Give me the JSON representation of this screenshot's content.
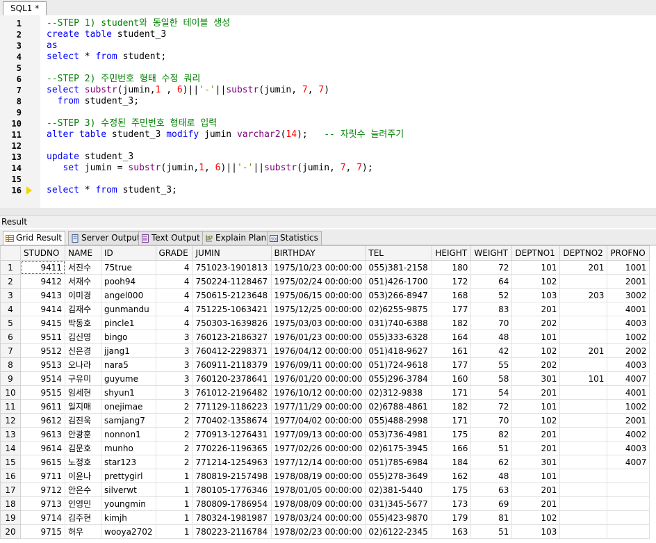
{
  "tab": {
    "title": "SQL1 *"
  },
  "editor": {
    "lines": [
      {
        "n": "1",
        "parts": [
          [
            "cmt",
            "--STEP 1) student와 동일한 테이블 생성"
          ]
        ]
      },
      {
        "n": "2",
        "parts": [
          [
            "kw",
            "create table "
          ],
          [
            "",
            "student_3"
          ]
        ]
      },
      {
        "n": "3",
        "parts": [
          [
            "kw",
            "as"
          ]
        ]
      },
      {
        "n": "4",
        "parts": [
          [
            "kw",
            "select "
          ],
          [
            "",
            "* "
          ],
          [
            "kw",
            "from "
          ],
          [
            "",
            "student;"
          ]
        ]
      },
      {
        "n": "5",
        "parts": []
      },
      {
        "n": "6",
        "parts": [
          [
            "cmt",
            "--STEP 2) 주민번호 형태 수정 쿼리"
          ]
        ]
      },
      {
        "n": "7",
        "parts": [
          [
            "kw",
            "select "
          ],
          [
            "fn",
            "substr"
          ],
          [
            "",
            "(jumin,"
          ],
          [
            "num",
            "1"
          ],
          [
            "",
            " , "
          ],
          [
            "num",
            "6"
          ],
          [
            "",
            ")||"
          ],
          [
            "str",
            "'-'"
          ],
          [
            "",
            "||"
          ],
          [
            "fn",
            "substr"
          ],
          [
            "",
            "(jumin, "
          ],
          [
            "num",
            "7"
          ],
          [
            "",
            ", "
          ],
          [
            "num",
            "7"
          ],
          [
            "",
            ")"
          ]
        ]
      },
      {
        "n": "8",
        "parts": [
          [
            "",
            "  "
          ],
          [
            "kw",
            "from "
          ],
          [
            "",
            "student_3;"
          ]
        ]
      },
      {
        "n": "9",
        "parts": []
      },
      {
        "n": "10",
        "parts": [
          [
            "cmt",
            "--STEP 3) 수정된 주민번호 형태로 입력"
          ]
        ]
      },
      {
        "n": "11",
        "parts": [
          [
            "kw",
            "alter table "
          ],
          [
            "",
            "student_3 "
          ],
          [
            "kw",
            "modify "
          ],
          [
            "",
            "jumin "
          ],
          [
            "fn",
            "varchar2"
          ],
          [
            "",
            "("
          ],
          [
            "num",
            "14"
          ],
          [
            "",
            ");   "
          ],
          [
            "cmt",
            "-- 자릿수 늘려주기"
          ]
        ]
      },
      {
        "n": "12",
        "parts": []
      },
      {
        "n": "13",
        "parts": [
          [
            "kw",
            "update "
          ],
          [
            "",
            "student_3"
          ]
        ]
      },
      {
        "n": "14",
        "parts": [
          [
            "",
            "   "
          ],
          [
            "kw",
            "set "
          ],
          [
            "",
            "jumin = "
          ],
          [
            "fn",
            "substr"
          ],
          [
            "",
            "(jumin,"
          ],
          [
            "num",
            "1"
          ],
          [
            "",
            ", "
          ],
          [
            "num",
            "6"
          ],
          [
            "",
            ")||"
          ],
          [
            "str",
            "'-'"
          ],
          [
            "",
            "||"
          ],
          [
            "fn",
            "substr"
          ],
          [
            "",
            "(jumin, "
          ],
          [
            "num",
            "7"
          ],
          [
            "",
            ", "
          ],
          [
            "num",
            "7"
          ],
          [
            "",
            ");"
          ]
        ]
      },
      {
        "n": "15",
        "parts": []
      },
      {
        "n": "16",
        "parts": [
          [
            "kw",
            "select "
          ],
          [
            "",
            "* "
          ],
          [
            "kw",
            "from "
          ],
          [
            "",
            "student_3;"
          ]
        ],
        "current": true
      }
    ]
  },
  "result": {
    "title": "Result",
    "tabs": [
      {
        "label": "Grid Result",
        "icon": "grid-icon",
        "active": true
      },
      {
        "label": "Server Output",
        "icon": "server-output-icon"
      },
      {
        "label": "Text Output",
        "icon": "text-output-icon"
      },
      {
        "label": "Explain Plan",
        "icon": "explain-plan-icon"
      },
      {
        "label": "Statistics",
        "icon": "statistics-icon"
      }
    ],
    "columns": [
      "STUDNO",
      "NAME",
      "ID",
      "GRADE",
      "JUMIN",
      "BIRTHDAY",
      "TEL",
      "HEIGHT",
      "WEIGHT",
      "DEPTNO1",
      "DEPTNO2",
      "PROFNO"
    ],
    "rows": [
      [
        "9411",
        "서진수",
        "75true",
        "4",
        "751023-1901813",
        "1975/10/23 00:00:00",
        "055)381-2158",
        "180",
        "72",
        "101",
        "201",
        "1001"
      ],
      [
        "9412",
        "서재수",
        "pooh94",
        "4",
        "750224-1128467",
        "1975/02/24 00:00:00",
        "051)426-1700",
        "172",
        "64",
        "102",
        "",
        "2001"
      ],
      [
        "9413",
        "이미경",
        "angel000",
        "4",
        "750615-2123648",
        "1975/06/15 00:00:00",
        "053)266-8947",
        "168",
        "52",
        "103",
        "203",
        "3002"
      ],
      [
        "9414",
        "김재수",
        "gunmandu",
        "4",
        "751225-1063421",
        "1975/12/25 00:00:00",
        "02)6255-9875",
        "177",
        "83",
        "201",
        "",
        "4001"
      ],
      [
        "9415",
        "박동호",
        "pincle1",
        "4",
        "750303-1639826",
        "1975/03/03 00:00:00",
        "031)740-6388",
        "182",
        "70",
        "202",
        "",
        "4003"
      ],
      [
        "9511",
        "김신영",
        "bingo",
        "3",
        "760123-2186327",
        "1976/01/23 00:00:00",
        "055)333-6328",
        "164",
        "48",
        "101",
        "",
        "1002"
      ],
      [
        "9512",
        "신은경",
        "jjang1",
        "3",
        "760412-2298371",
        "1976/04/12 00:00:00",
        "051)418-9627",
        "161",
        "42",
        "102",
        "201",
        "2002"
      ],
      [
        "9513",
        "오나라",
        "nara5",
        "3",
        "760911-2118379",
        "1976/09/11 00:00:00",
        "051)724-9618",
        "177",
        "55",
        "202",
        "",
        "4003"
      ],
      [
        "9514",
        "구유미",
        "guyume",
        "3",
        "760120-2378641",
        "1976/01/20 00:00:00",
        "055)296-3784",
        "160",
        "58",
        "301",
        "101",
        "4007"
      ],
      [
        "9515",
        "임세현",
        "shyun1",
        "3",
        "761012-2196482",
        "1976/10/12 00:00:00",
        "02)312-9838",
        "171",
        "54",
        "201",
        "",
        "4001"
      ],
      [
        "9611",
        "일지매",
        "onejimae",
        "2",
        "771129-1186223",
        "1977/11/29 00:00:00",
        "02)6788-4861",
        "182",
        "72",
        "101",
        "",
        "1002"
      ],
      [
        "9612",
        "김진욱",
        "samjang7",
        "2",
        "770402-1358674",
        "1977/04/02 00:00:00",
        "055)488-2998",
        "171",
        "70",
        "102",
        "",
        "2001"
      ],
      [
        "9613",
        "안광훈",
        "nonnon1",
        "2",
        "770913-1276431",
        "1977/09/13 00:00:00",
        "053)736-4981",
        "175",
        "82",
        "201",
        "",
        "4002"
      ],
      [
        "9614",
        "김문호",
        "munho",
        "2",
        "770226-1196365",
        "1977/02/26 00:00:00",
        "02)6175-3945",
        "166",
        "51",
        "201",
        "",
        "4003"
      ],
      [
        "9615",
        "노정호",
        "star123",
        "2",
        "771214-1254963",
        "1977/12/14 00:00:00",
        "051)785-6984",
        "184",
        "62",
        "301",
        "",
        "4007"
      ],
      [
        "9711",
        "이윤나",
        "prettygirl",
        "1",
        "780819-2157498",
        "1978/08/19 00:00:00",
        "055)278-3649",
        "162",
        "48",
        "101",
        "",
        ""
      ],
      [
        "9712",
        "안은수",
        "silverwt",
        "1",
        "780105-1776346",
        "1978/01/05 00:00:00",
        "02)381-5440",
        "175",
        "63",
        "201",
        "",
        ""
      ],
      [
        "9713",
        "인영민",
        "youngmin",
        "1",
        "780809-1786954",
        "1978/08/09 00:00:00",
        "031)345-5677",
        "173",
        "69",
        "201",
        "",
        ""
      ],
      [
        "9714",
        "김주현",
        "kimjh",
        "1",
        "780324-1981987",
        "1978/03/24 00:00:00",
        "055)423-9870",
        "179",
        "81",
        "102",
        "",
        ""
      ],
      [
        "9715",
        "허우",
        "wooya2702",
        "1",
        "780223-2116784",
        "1978/02/23 00:00:00",
        "02)6122-2345",
        "163",
        "51",
        "103",
        "",
        ""
      ]
    ]
  }
}
